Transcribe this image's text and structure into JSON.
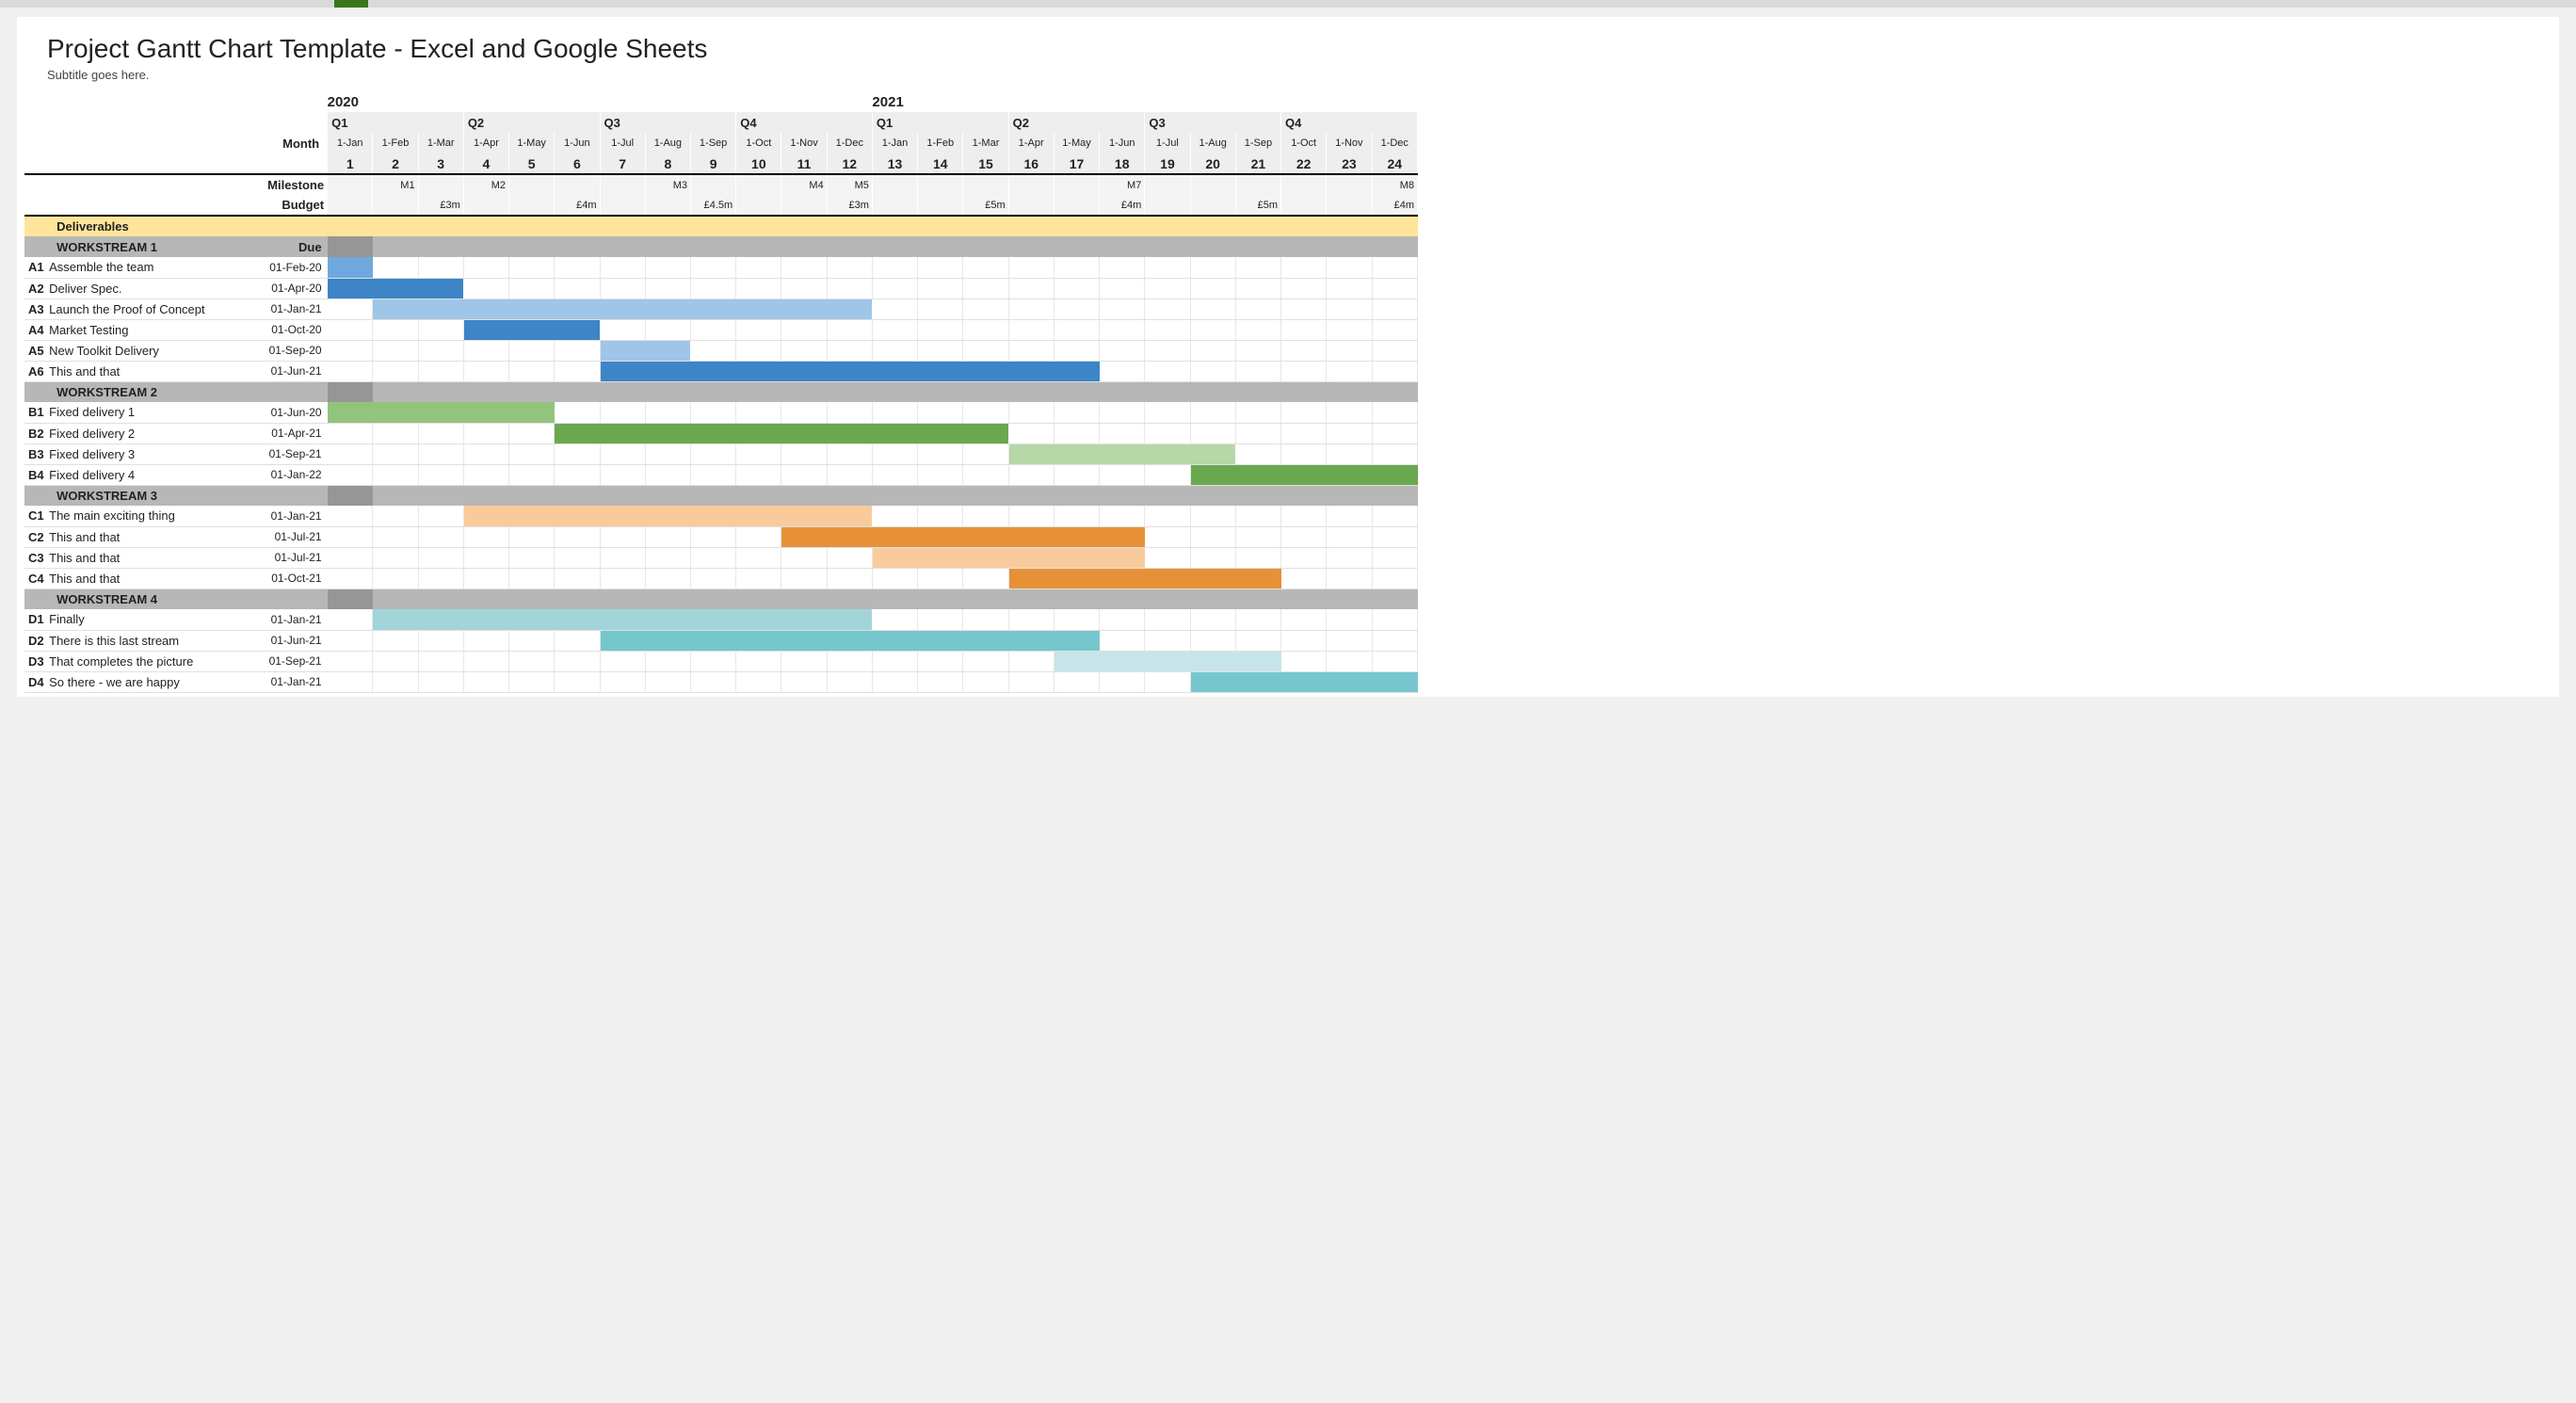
{
  "title": "Project Gantt Chart Template - Excel and Google Sheets",
  "subtitle": "Subtitle goes here.",
  "labels": {
    "month": "Month",
    "milestone": "Milestone",
    "budget": "Budget",
    "deliverables": "Deliverables",
    "due": "Due"
  },
  "years": [
    "2020",
    "2021"
  ],
  "quarters": [
    "Q1",
    "Q2",
    "Q3",
    "Q4",
    "Q1",
    "Q2",
    "Q3",
    "Q4"
  ],
  "months": [
    "1-Jan",
    "1-Feb",
    "1-Mar",
    "1-Apr",
    "1-May",
    "1-Jun",
    "1-Jul",
    "1-Aug",
    "1-Sep",
    "1-Oct",
    "1-Nov",
    "1-Dec",
    "1-Jan",
    "1-Feb",
    "1-Mar",
    "1-Apr",
    "1-May",
    "1-Jun",
    "1-Jul",
    "1-Aug",
    "1-Sep",
    "1-Oct",
    "1-Nov",
    "1-Dec"
  ],
  "month_nums": [
    "1",
    "2",
    "3",
    "4",
    "5",
    "6",
    "7",
    "8",
    "9",
    "10",
    "11",
    "12",
    "13",
    "14",
    "15",
    "16",
    "17",
    "18",
    "19",
    "20",
    "21",
    "22",
    "23",
    "24"
  ],
  "milestones": [
    "",
    "M1",
    "",
    "M2",
    "",
    "",
    "",
    "M3",
    "",
    "",
    "M4",
    "M5",
    "",
    "",
    "",
    "",
    "",
    "M7",
    "",
    "",
    "",
    "",
    "",
    "M8"
  ],
  "budgets": [
    "",
    "",
    "£3m",
    "",
    "",
    "£4m",
    "",
    "",
    "£4.5m",
    "",
    "",
    "£3m",
    "",
    "",
    "£5m",
    "",
    "",
    "£4m",
    "",
    "",
    "£5m",
    "",
    "",
    "£4m"
  ],
  "workstreams": [
    {
      "name": "WORKSTREAM 1"
    },
    {
      "name": "WORKSTREAM 2"
    },
    {
      "name": "WORKSTREAM 3"
    },
    {
      "name": "WORKSTREAM 4"
    }
  ],
  "tasks": [
    {
      "id": "A1",
      "name": "Assemble the team",
      "due": "01-Feb-20"
    },
    {
      "id": "A2",
      "name": "Deliver Spec.",
      "due": "01-Apr-20"
    },
    {
      "id": "A3",
      "name": "Launch the Proof of Concept",
      "due": "01-Jan-21"
    },
    {
      "id": "A4",
      "name": "Market Testing",
      "due": "01-Oct-20"
    },
    {
      "id": "A5",
      "name": "New Toolkit Delivery",
      "due": "01-Sep-20"
    },
    {
      "id": "A6",
      "name": "This and that",
      "due": "01-Jun-21"
    },
    {
      "id": "B1",
      "name": "Fixed delivery 1",
      "due": "01-Jun-20"
    },
    {
      "id": "B2",
      "name": "Fixed delivery 2",
      "due": "01-Apr-21"
    },
    {
      "id": "B3",
      "name": "Fixed delivery 3",
      "due": "01-Sep-21"
    },
    {
      "id": "B4",
      "name": "Fixed delivery 4",
      "due": "01-Jan-22"
    },
    {
      "id": "C1",
      "name": "The main exciting thing",
      "due": "01-Jan-21"
    },
    {
      "id": "C2",
      "name": "This and that",
      "due": "01-Jul-21"
    },
    {
      "id": "C3",
      "name": "This and that",
      "due": "01-Jul-21"
    },
    {
      "id": "C4",
      "name": "This and that",
      "due": "01-Oct-21"
    },
    {
      "id": "D1",
      "name": "Finally",
      "due": "01-Jan-21"
    },
    {
      "id": "D2",
      "name": "There is this last stream",
      "due": "01-Jun-21"
    },
    {
      "id": "D3",
      "name": "That completes the picture",
      "due": "01-Sep-21"
    },
    {
      "id": "D4",
      "name": "So there - we are happy",
      "due": "01-Jan-21"
    }
  ],
  "chart_data": {
    "type": "bar",
    "title": "Project Gantt Chart Template",
    "xlabel": "Month",
    "ylabel": "",
    "x": [
      1,
      2,
      3,
      4,
      5,
      6,
      7,
      8,
      9,
      10,
      11,
      12,
      13,
      14,
      15,
      16,
      17,
      18,
      19,
      20,
      21,
      22,
      23,
      24
    ],
    "series": [
      {
        "name": "A1 Assemble the team",
        "start": 1,
        "end": 1,
        "color": "#6fa8dc"
      },
      {
        "name": "A2 Deliver Spec.",
        "start": 1,
        "end": 3,
        "color": "#3d85c6"
      },
      {
        "name": "A3 Launch the Proof of Concept",
        "start": 2,
        "end": 12,
        "color": "#9fc5e8"
      },
      {
        "name": "A4 Market Testing",
        "start": 4,
        "end": 6,
        "color": "#3d85c6"
      },
      {
        "name": "A5 New Toolkit Delivery",
        "start": 7,
        "end": 8,
        "color": "#9fc5e8"
      },
      {
        "name": "A6 This and that",
        "start": 7,
        "end": 17,
        "color": "#3d85c6"
      },
      {
        "name": "B1 Fixed delivery 1",
        "start": 1,
        "end": 5,
        "color": "#93c47d"
      },
      {
        "name": "B2 Fixed delivery 2",
        "start": 6,
        "end": 15,
        "color": "#6aa84f"
      },
      {
        "name": "B3 Fixed delivery 3",
        "start": 16,
        "end": 20,
        "color": "#b6d7a8"
      },
      {
        "name": "B4 Fixed delivery 4",
        "start": 20,
        "end": 24,
        "color": "#6aa84f"
      },
      {
        "name": "C1 The main exciting thing",
        "start": 4,
        "end": 12,
        "color": "#f9cb9c"
      },
      {
        "name": "C2 This and that",
        "start": 11,
        "end": 18,
        "color": "#e69138"
      },
      {
        "name": "C3 This and that",
        "start": 13,
        "end": 18,
        "color": "#f9cb9c"
      },
      {
        "name": "C4 This and that",
        "start": 16,
        "end": 21,
        "color": "#e69138"
      },
      {
        "name": "D1 Finally",
        "start": 2,
        "end": 12,
        "color": "#a2d5d9"
      },
      {
        "name": "D2 There is this last stream",
        "start": 7,
        "end": 17,
        "color": "#76c7cd"
      },
      {
        "name": "D3 That completes the picture",
        "start": 17,
        "end": 21,
        "color": "#c6e5e8"
      },
      {
        "name": "D4 So there - we are happy",
        "start": 20,
        "end": 24,
        "color": "#76c7cd"
      }
    ],
    "milestones": {
      "2": "M1",
      "4": "M2",
      "8": "M3",
      "11": "M4",
      "12": "M5",
      "18": "M7",
      "24": "M8"
    },
    "budgets": {
      "3": "£3m",
      "6": "£4m",
      "9": "£4.5m",
      "12": "£3m",
      "15": "£5m",
      "18": "£4m",
      "21": "£5m",
      "24": "£4m"
    }
  }
}
